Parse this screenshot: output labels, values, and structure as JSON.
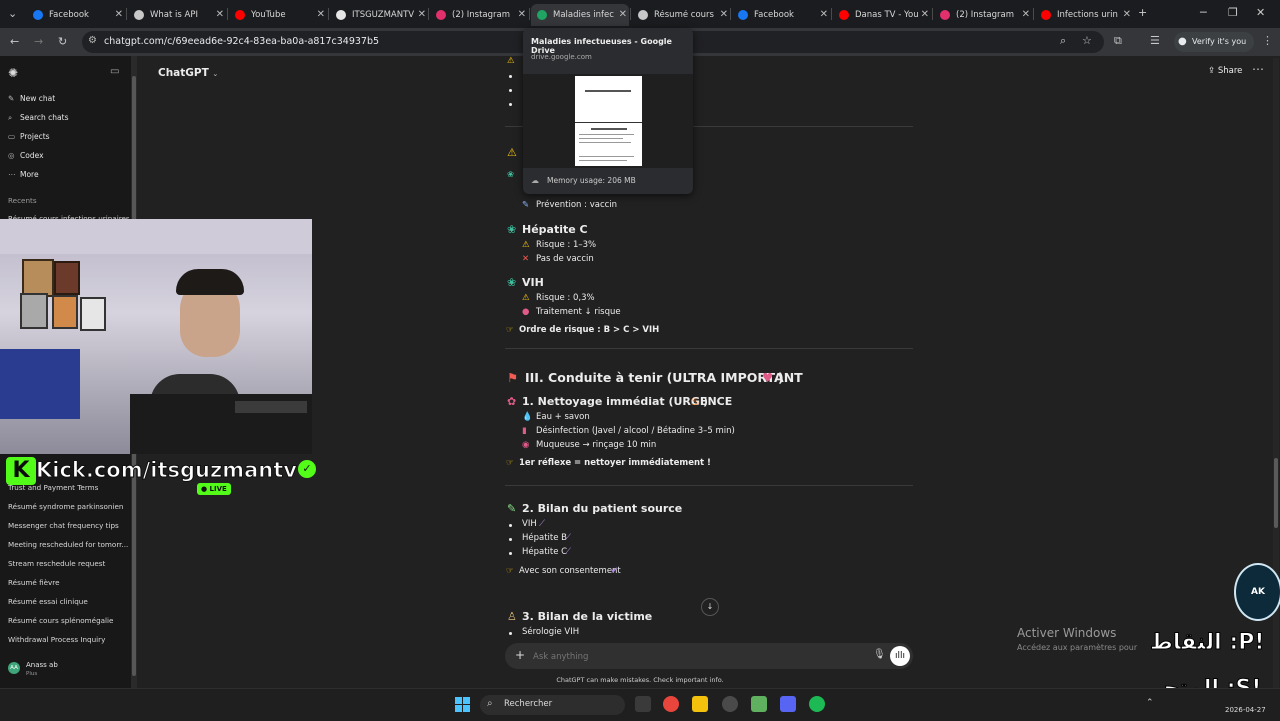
{
  "browser": {
    "tabs": [
      {
        "label": "Facebook",
        "color": "#1877f2"
      },
      {
        "label": "What is API",
        "color": "#c8c8c8"
      },
      {
        "label": "YouTube",
        "color": "#ff0000"
      },
      {
        "label": "ITSGUZMANTV",
        "color": "#e6e6e6"
      },
      {
        "label": "(2) Instagram",
        "color": "#e1306c"
      },
      {
        "label": "Maladies infec",
        "color": "#1fa463",
        "active": true
      },
      {
        "label": "Résumé cours",
        "color": "#c8c8c8"
      },
      {
        "label": "Facebook",
        "color": "#1877f2"
      },
      {
        "label": "Danas TV - You",
        "color": "#ff0000"
      },
      {
        "label": "(2) Instagram",
        "color": "#e1306c"
      },
      {
        "label": "Infections urin",
        "color": "#ff0000"
      }
    ],
    "url": "chatgpt.com/c/69eead6e-92c4-83ea-ba0a-a817c34937b5",
    "verify_label": "Verify it's you"
  },
  "tooltip": {
    "title": "Maladies infectueuses - Google Drive",
    "domain": "drive.google.com",
    "memory": "Memory usage: 206 MB"
  },
  "sidebar": {
    "items": [
      {
        "label": "New chat",
        "icon": "edit-icon"
      },
      {
        "label": "Search chats",
        "icon": "search-icon"
      },
      {
        "label": "Projects",
        "icon": "folder-icon"
      },
      {
        "label": "Codex",
        "icon": "codex-icon"
      },
      {
        "label": "More",
        "icon": "more-icon"
      }
    ],
    "recents_label": "Recents",
    "recents": [
      "Résumé cours infections urinaires",
      "Trust and Payment Terms",
      "Résumé syndrome parkinsonien",
      "Messenger chat frequency tips",
      "Meeting rescheduled for tomorr...",
      "Stream reschedule request",
      "Résumé fièvre",
      "Résumé essai clinique",
      "Résumé cours splénomégalie",
      "Withdrawal Process Inquiry"
    ],
    "user_name": "Anass ab",
    "user_plan": "Plus",
    "user_initials": "AA"
  },
  "header": {
    "model": "ChatGPT",
    "share": "Share"
  },
  "content": {
    "prev": "Prévention : vaccin",
    "hepc": {
      "title": "Hépatite C",
      "risque": "Risque : 1–3%",
      "vaccin": "Pas de vaccin"
    },
    "vih": {
      "title": "VIH",
      "risque": "Risque : 0,3%",
      "traitement": "Traitement ↓ risque"
    },
    "ordre": "Ordre de risque : B > C > VIH",
    "section3": "III. Conduite à tenir (ULTRA IMPORTANT",
    "nettoyage": {
      "title": "1. Nettoyage immédiat (URGENCE",
      "items": [
        "Eau + savon",
        "Désinfection (Javel / alcool / Bétadine 3–5 min)",
        "Muqueuse → rinçage 10 min"
      ],
      "reflexe": "1er réflexe = nettoyer immédiatement !"
    },
    "bilan_source": {
      "title": "2. Bilan du patient source",
      "items": [
        "VIH",
        "Hépatite B",
        "Hépatite C"
      ],
      "consent": "Avec son consentement"
    },
    "bilan_victime": {
      "title": "3. Bilan de la victime",
      "items": [
        "Sérologie VIH"
      ]
    }
  },
  "composer": {
    "placeholder": "Ask anything",
    "disclaimer": "ChatGPT can make mistakes. Check important info."
  },
  "overlay": {
    "kick": "Kick.com/itsguzmantv",
    "live": "LIVE",
    "watermark_title": "Activer Windows",
    "watermark_sub": "Accédez aux paramètres pour",
    "arabic1": "النقاط :P!",
    "arabic2": "المتجر :S!",
    "badge": "AK"
  },
  "taskbar": {
    "search": "Rechercher",
    "date": "2026-04-27"
  }
}
